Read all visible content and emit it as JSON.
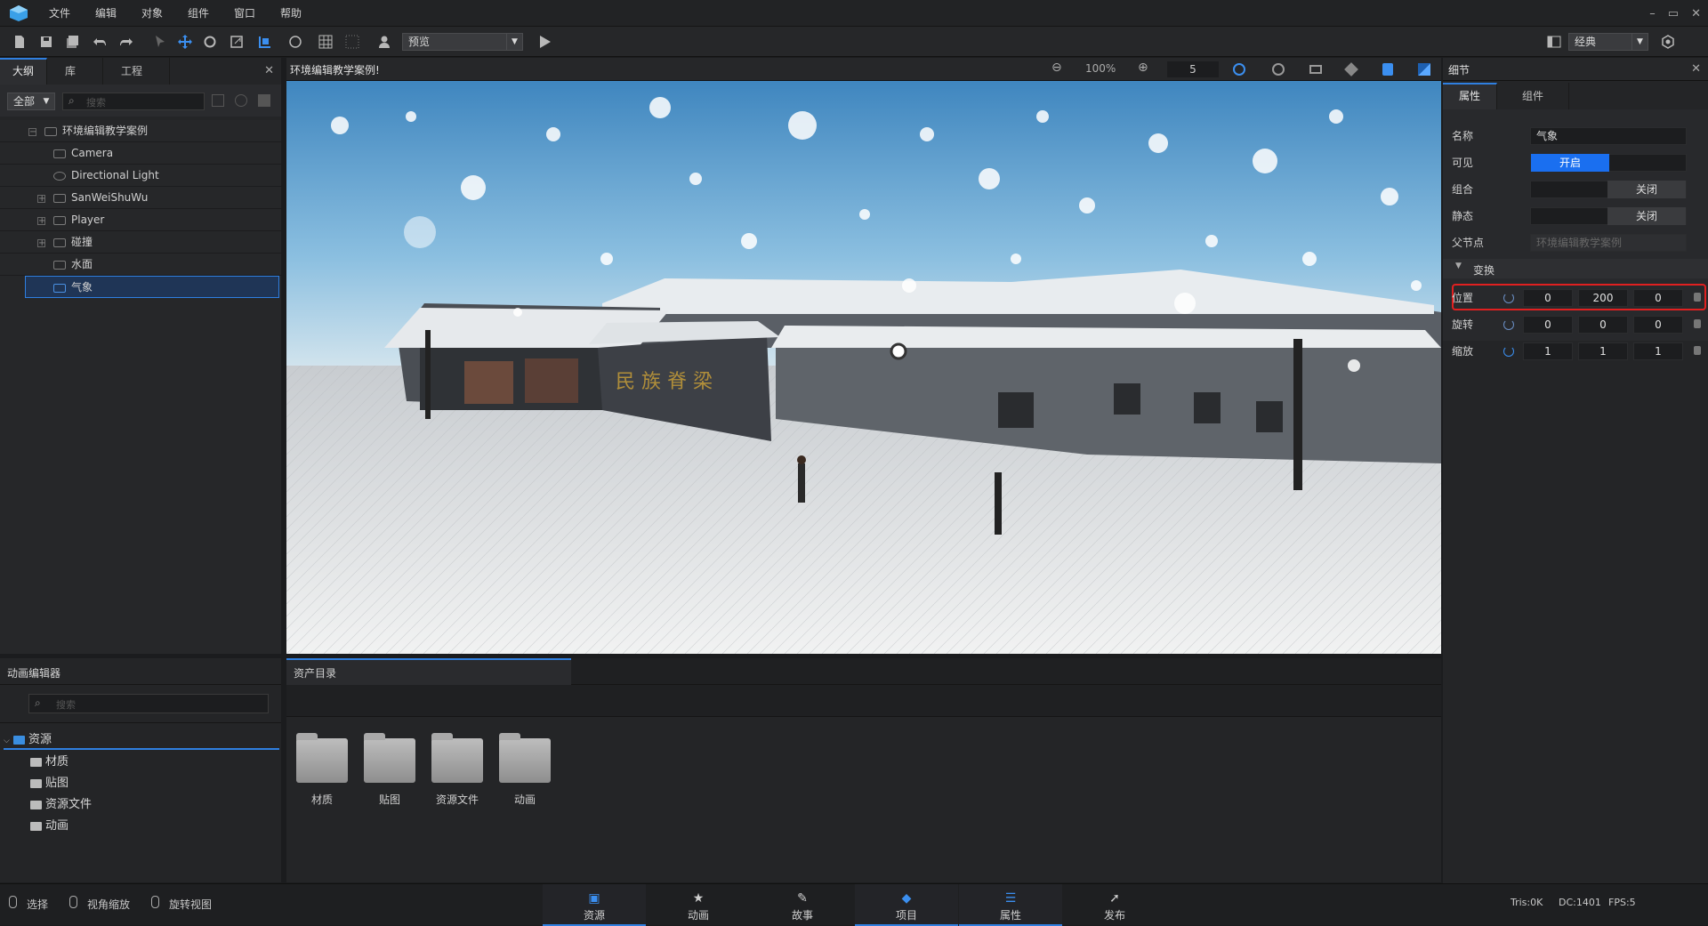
{
  "menubar": {
    "items": [
      "文件",
      "编辑",
      "对象",
      "组件",
      "窗口",
      "帮助"
    ],
    "window_controls": [
      "–",
      "▭",
      "✕"
    ]
  },
  "toolbar": {
    "mode_select": "预览",
    "layout_select": "经典"
  },
  "outline": {
    "tabs": [
      "大纲",
      "库",
      "工程"
    ],
    "filter": "全部",
    "search_placeholder": "搜索",
    "items": [
      {
        "label": "环境编辑教学案例",
        "icon": "scene-icon"
      },
      {
        "label": "Camera",
        "icon": "camera-icon"
      },
      {
        "label": "Directional Light",
        "icon": "light-icon"
      },
      {
        "label": "SanWeiShuWu",
        "icon": "object-icon"
      },
      {
        "label": "Player",
        "icon": "object-icon"
      },
      {
        "label": "碰撞",
        "icon": "object-icon"
      },
      {
        "label": "水面",
        "icon": "object-icon"
      },
      {
        "label": "气象",
        "icon": "object-icon"
      }
    ]
  },
  "viewport": {
    "title": "环境编辑教学案例!",
    "zoom": "100%",
    "speed": "5",
    "sign_text": "民 族 脊 梁"
  },
  "details": {
    "title": "细节",
    "tabs": [
      "属性",
      "组件"
    ],
    "name_label": "名称",
    "name_value": "气象",
    "visible_label": "可见",
    "visible_on": "开启",
    "group_label": "组合",
    "group_off": "关闭",
    "static_label": "静态",
    "static_off": "关闭",
    "parent_label": "父节点",
    "parent_value": "环境编辑教学案例",
    "transform_label": "变换",
    "position": {
      "label": "位置",
      "x": "0",
      "y": "200",
      "z": "0"
    },
    "rotation": {
      "label": "旋转",
      "x": "0",
      "y": "0",
      "z": "0"
    },
    "scale": {
      "label": "缩放",
      "x": "1",
      "y": "1",
      "z": "1"
    }
  },
  "anim_editor": {
    "title": "动画编辑器",
    "search_placeholder": "搜索",
    "root": "资源",
    "children": [
      "材质",
      "贴图",
      "资源文件",
      "动画"
    ]
  },
  "assets": {
    "tab": "资产目录",
    "folders": [
      "材质",
      "贴图",
      "资源文件",
      "动画"
    ]
  },
  "statusbar": {
    "hints": [
      "选择",
      "视角缩放",
      "旋转视图"
    ],
    "tabs": [
      "资源",
      "动画",
      "故事",
      "项目",
      "属性",
      "发布"
    ],
    "stats": {
      "tris": "Tris:0K",
      "dc": "DC:1401",
      "fps": "FPS:5"
    }
  },
  "colors": {
    "accent": "#2f7fe0",
    "highlight_box": "#e02020"
  }
}
